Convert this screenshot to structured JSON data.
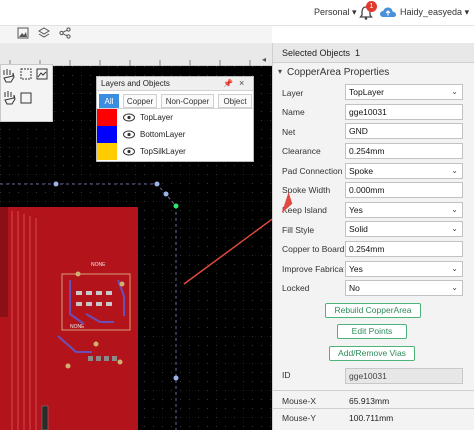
{
  "topbar": {
    "account_menu": "Personal",
    "notification_count": "1",
    "username": "Haidy_easyeda"
  },
  "layers_panel": {
    "title": "Layers and Objects",
    "tabs": [
      "All",
      "Copper",
      "Non-Copper",
      "Object"
    ],
    "active_tab": "All",
    "layers": [
      {
        "name": "TopLayer",
        "color": "#ff0000"
      },
      {
        "name": "BottomLayer",
        "color": "#0000ff"
      },
      {
        "name": "TopSilkLayer",
        "color": "#ffcc00"
      }
    ]
  },
  "canvas": {
    "board_label_1": "NONE",
    "board_label_2": "NONE"
  },
  "right_panel": {
    "selected_label": "Selected Objects",
    "selected_count": "1",
    "section_title": "CopperArea Properties",
    "properties": [
      {
        "label": "Layer",
        "value": "TopLayer",
        "type": "select"
      },
      {
        "label": "Name",
        "value": "gge10031",
        "type": "input"
      },
      {
        "label": "Net",
        "value": "GND",
        "type": "input"
      },
      {
        "label": "Clearance",
        "value": "0.254mm",
        "type": "input"
      },
      {
        "label": "Pad Connection",
        "value": "Spoke",
        "type": "select"
      },
      {
        "label": "Spoke Width",
        "value": "0.000mm",
        "type": "input"
      },
      {
        "label": "Keep Island",
        "value": "Yes",
        "type": "select"
      },
      {
        "label": "Fill Style",
        "value": "Solid",
        "type": "select"
      },
      {
        "label": "Copper to Board",
        "value": "0.254mm",
        "type": "input"
      },
      {
        "label": "Improve Fabrication",
        "value": "Yes",
        "type": "select"
      },
      {
        "label": "Locked",
        "value": "No",
        "type": "select"
      }
    ],
    "buttons": {
      "rebuild": "Rebuild CopperArea",
      "edit_points": "Edit Points",
      "add_remove_vias": "Add/Remove Vias"
    },
    "id_label": "ID",
    "id_value": "gge10031",
    "mouse": [
      {
        "label": "Mouse-X",
        "value": "65.913mm"
      },
      {
        "label": "Mouse-Y",
        "value": "100.711mm"
      }
    ]
  },
  "colors": {
    "canvas_bg": "#000000",
    "board_red": "#b3141c",
    "accent_blue": "#3b8de0",
    "button_green": "#4db37b",
    "arrow_red": "#e0493f"
  }
}
